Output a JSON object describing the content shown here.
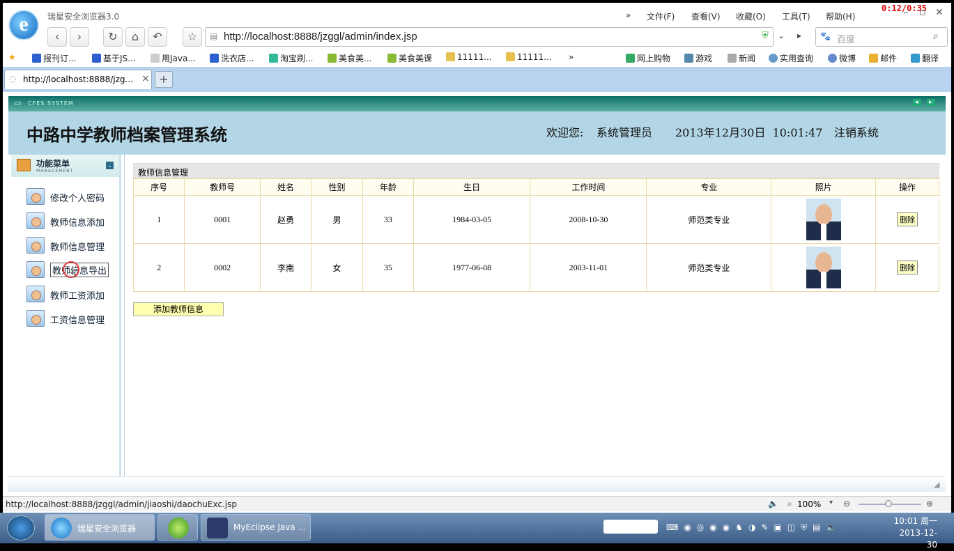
{
  "browser": {
    "app_title": "瑞星安全浏览器3.0",
    "menus": [
      "文件(F)",
      "查看(V)",
      "收藏(O)",
      "工具(T)",
      "帮助(H)"
    ],
    "overflow": "»",
    "recording_timer": "0:12/0:35",
    "address": "http://localhost:8888/jzggl/admin/index.jsp",
    "search_placeholder": "百度",
    "bookmarks": [
      "报刊订...",
      "基于JS...",
      "用Java...",
      "洗衣店...",
      "淘宝刷...",
      "美食美...",
      "美食美课",
      "11111...",
      "11111..."
    ],
    "bookmarks_more": "»",
    "bookmarks_right": [
      "网上购物",
      "游戏",
      "新闻",
      "实用查询",
      "微博",
      "邮件",
      "翻译"
    ],
    "tab_title": "http://localhost:8888/jzg...",
    "tab_close": "×",
    "tab_new": "+",
    "status_url": "http://localhost:8888/jzggl/admin/jiaoshi/daochuExc.jsp",
    "zoom": "100%"
  },
  "page": {
    "banner": "CFES SYSTEM",
    "title": "中路中学教师档案管理系统",
    "welcome": "欢迎您:",
    "user": "系统管理员",
    "datetime": "2013年12月30日  10:01:47",
    "logout": "注销系统"
  },
  "sidebar": {
    "header": "功能菜单",
    "header_sub": "MANAGEMENT",
    "items": [
      {
        "label": "修改个人密码"
      },
      {
        "label": "教师信息添加"
      },
      {
        "label": "教师信息管理"
      },
      {
        "label": "教师信息导出"
      },
      {
        "label": "教师工资添加"
      },
      {
        "label": "工资信息管理"
      }
    ]
  },
  "main": {
    "panel_title": "教师信息管理",
    "columns": [
      "序号",
      "教师号",
      "姓名",
      "性别",
      "年龄",
      "生日",
      "工作时间",
      "专业",
      "照片",
      "操作"
    ],
    "rows": [
      {
        "seq": "1",
        "id": "0001",
        "name": "赵勇",
        "gender": "男",
        "age": "33",
        "birthday": "1984-03-05",
        "work_date": "2008-10-30",
        "major": "师范类专业",
        "action": "删除"
      },
      {
        "seq": "2",
        "id": "0002",
        "name": "李南",
        "gender": "女",
        "age": "35",
        "birthday": "1977-06-08",
        "work_date": "2003-11-01",
        "major": "师范类专业",
        "action": "删除"
      }
    ],
    "add_button": "添加教师信息"
  },
  "taskbar": {
    "tasks": [
      "瑞星安全浏览器",
      "",
      "MyEclipse Java ..."
    ],
    "time": "10:01 周一",
    "date": "2013-12-30"
  }
}
